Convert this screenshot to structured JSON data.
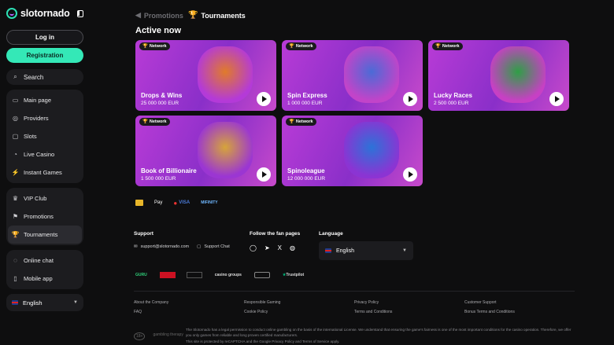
{
  "brand": {
    "name": "slotornado"
  },
  "auth": {
    "login": "Log in",
    "register": "Registration"
  },
  "search": {
    "label": "Search"
  },
  "nav_groups": [
    [
      {
        "label": "Main page",
        "icon": "home-icon"
      },
      {
        "label": "Providers",
        "icon": "providers-icon"
      },
      {
        "label": "Slots",
        "icon": "slots-icon"
      },
      {
        "label": "Live Casino",
        "icon": "live-casino-icon"
      },
      {
        "label": "Instant Games",
        "icon": "instant-games-icon"
      }
    ],
    [
      {
        "label": "VIP Club",
        "icon": "vip-icon"
      },
      {
        "label": "Promotions",
        "icon": "promotions-icon"
      },
      {
        "label": "Tournaments",
        "icon": "tournaments-icon",
        "active": true
      }
    ],
    [
      {
        "label": "Online chat",
        "icon": "chat-icon"
      },
      {
        "label": "Mobile app",
        "icon": "mobile-icon"
      }
    ]
  ],
  "language": {
    "current": "English"
  },
  "tabs": {
    "promotions": "Promotions",
    "tournaments": "Tournaments"
  },
  "active_heading": "Active now",
  "tournaments": [
    {
      "badge": "Network",
      "title": "Drops & Wins",
      "amount": "25 000 000 EUR",
      "colors": [
        "#b43ad8",
        "#e07b2a"
      ]
    },
    {
      "badge": "Network",
      "title": "Spin Express",
      "amount": "1 000 000 EUR",
      "colors": [
        "#c244c9",
        "#4b6bd6"
      ]
    },
    {
      "badge": "Network",
      "title": "Lucky Races",
      "amount": "2 500 000 EUR",
      "colors": [
        "#c740c4",
        "#2f9f46"
      ]
    },
    {
      "badge": "Network",
      "title": "Book of Billionaire",
      "amount": "1 500 000 EUR",
      "colors": [
        "#9b36d2",
        "#d6a43a"
      ]
    },
    {
      "badge": "Network",
      "title": "Spinoleague",
      "amount": "12 000 000 EUR",
      "colors": [
        "#8b34d3",
        "#2c73d8"
      ]
    }
  ],
  "payments": [
    "Pay",
    "VISA",
    "MIFINITY"
  ],
  "footer": {
    "support": {
      "heading": "Support",
      "email": "support@slotornado.com",
      "chat": "Support Chat"
    },
    "follow": {
      "heading": "Follow the fan pages"
    },
    "language": {
      "heading": "Language",
      "current": "English"
    },
    "partners": [
      "GURU",
      "",
      "",
      "casino groups",
      "",
      "Trustpilot"
    ],
    "links": [
      "About the Company",
      "Responsible Gaming",
      "Privacy Policy",
      "Customer Support",
      "FAQ",
      "Cookie Policy",
      "Terms and Conditions",
      "Bonus Terms and Conditions"
    ],
    "legal1": "The Slotornado has a legal permission to conduct online gambling on the basis of the international License. We understand that ensuring the game's fairness is one of the most important conditions for the casino operation. Therefore, we offer you only games from reliable and long proven certified manufacturers.",
    "legal2": "This site is protected by reCAPTCHA and the Google Privacy Policy and Terms of Service apply.",
    "seals": [
      "18+",
      "gambling therapy"
    ]
  }
}
